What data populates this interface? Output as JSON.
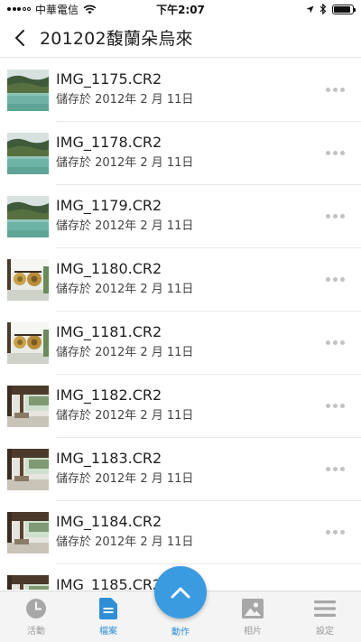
{
  "status_bar": {
    "carrier": "中華電信",
    "time": "下午2:07",
    "battery_level": 0.9
  },
  "header": {
    "title": "201202馥蘭朵烏來"
  },
  "files": [
    {
      "name": "IMG_1175.CR2",
      "saved": "儲存於 2012年 2 月 11日",
      "thumb": "lake"
    },
    {
      "name": "IMG_1178.CR2",
      "saved": "儲存於 2012年 2 月 11日",
      "thumb": "lake"
    },
    {
      "name": "IMG_1179.CR2",
      "saved": "儲存於 2012年 2 月 11日",
      "thumb": "lake"
    },
    {
      "name": "IMG_1180.CR2",
      "saved": "儲存於 2012年 2 月 11日",
      "thumb": "gongs"
    },
    {
      "name": "IMG_1181.CR2",
      "saved": "儲存於 2012年 2 月 11日",
      "thumb": "gongs"
    },
    {
      "name": "IMG_1182.CR2",
      "saved": "儲存於 2012年 2 月 11日",
      "thumb": "room"
    },
    {
      "name": "IMG_1183.CR2",
      "saved": "儲存於 2012年 2 月 11日",
      "thumb": "room"
    },
    {
      "name": "IMG_1184.CR2",
      "saved": "儲存於 2012年 2 月 11日",
      "thumb": "room"
    },
    {
      "name": "IMG_1185.CR2",
      "saved": "",
      "thumb": "room"
    }
  ],
  "tabs": [
    {
      "label": "活動",
      "icon": "clock-icon"
    },
    {
      "label": "檔案",
      "icon": "file-icon"
    },
    {
      "label": "動作",
      "icon": "chevron-up-icon"
    },
    {
      "label": "相片",
      "icon": "photo-icon"
    },
    {
      "label": "設定",
      "icon": "menu-icon"
    }
  ],
  "colors": {
    "accent": "#3b9be0",
    "tab_inactive": "#9b9b9b",
    "tab_bar_bg": "#f4f4f4"
  }
}
